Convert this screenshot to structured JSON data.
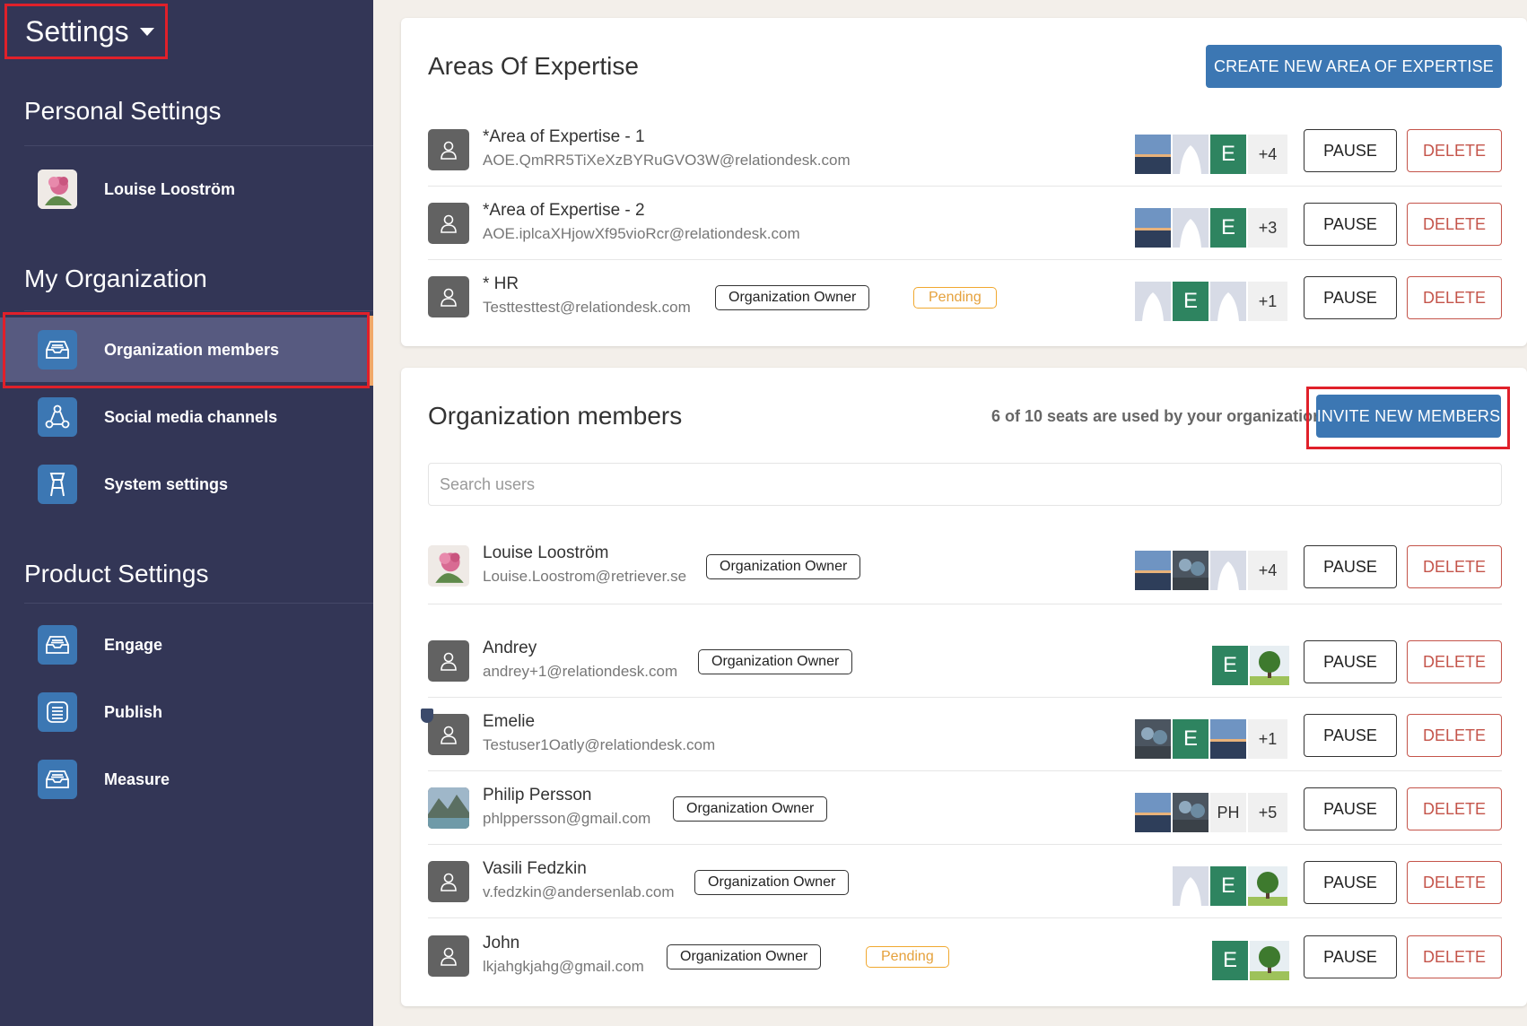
{
  "sidebar": {
    "title": "Settings",
    "sections": {
      "personal": "Personal Settings",
      "organization": "My Organization",
      "product": "Product Settings"
    },
    "user_name": "Louise Looström",
    "org_items": [
      "Organization members",
      "Social media channels",
      "System settings"
    ],
    "product_items": [
      "Engage",
      "Publish",
      "Measure"
    ]
  },
  "expertise": {
    "title": "Areas Of Expertise",
    "create_label": "CREATE NEW AREA OF EXPERTISE",
    "rows": [
      {
        "name": "*Area of Expertise - 1",
        "email": "AOE.QmRR5TiXeXzBYRuGVO3W@relationdesk.com",
        "more": "+4"
      },
      {
        "name": "*Area of Expertise - 2",
        "email": "AOE.iplcaXHjowXf95vioRcr@relationdesk.com",
        "more": "+3"
      },
      {
        "name": "* HR",
        "email": "Testtesttest@relationdesk.com",
        "badge": "Organization Owner",
        "pending": "Pending",
        "more": "+1"
      }
    ]
  },
  "members": {
    "title": "Organization members",
    "seats": "6 of 10 seats are used by your organization",
    "invite_label": "INVITE NEW MEMBERS",
    "search_placeholder": "Search users",
    "rows": [
      {
        "name": "Louise Looström",
        "email": "Louise.Loostrom@retriever.se",
        "badge": "Organization Owner",
        "more": "+4"
      },
      {
        "name": "Andrey",
        "email": "andrey+1@relationdesk.com",
        "badge": "Organization Owner"
      },
      {
        "name": "Emelie",
        "email": "Testuser1Oatly@relationdesk.com",
        "more": "+1"
      },
      {
        "name": "Philip Persson",
        "email": "phlppersson@gmail.com",
        "badge": "Organization Owner",
        "initials": "PH",
        "more": "+5"
      },
      {
        "name": "Vasili Fedzkin",
        "email": "v.fedzkin@andersenlab.com",
        "badge": "Organization Owner"
      },
      {
        "name": "John",
        "email": "lkjahgkjahg@gmail.com",
        "badge": "Organization Owner",
        "pending": "Pending"
      }
    ]
  },
  "labels": {
    "pause": "PAUSE",
    "delete": "DELETE",
    "e_initial": "E"
  },
  "colors": {
    "sidebar_bg": "#333656",
    "accent_blue": "#3c77b3",
    "highlight_red": "#e0202a",
    "delete_red": "#c4544a",
    "pending_orange": "#f0a830",
    "e_green": "#2e8460"
  }
}
